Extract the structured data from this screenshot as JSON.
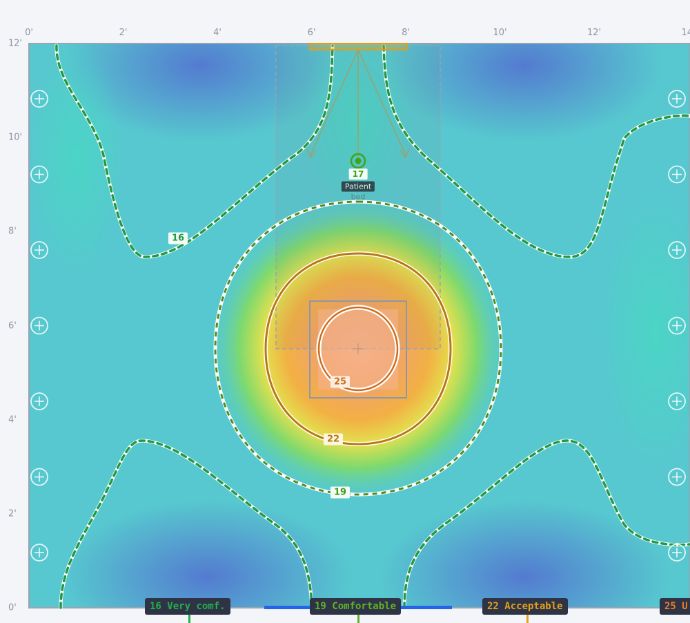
{
  "floorplan": {
    "x_ticks": [
      "0'",
      "2'",
      "4'",
      "6'",
      "8'",
      "10'",
      "12'",
      "14'"
    ],
    "y_ticks": [
      "12'",
      "10'",
      "8'",
      "6'",
      "4'",
      "2'",
      "0'"
    ],
    "contours": [
      {
        "value": "16",
        "color": "#1f9a45"
      },
      {
        "value": "25",
        "color": "#cf6d1c"
      },
      {
        "value": "22",
        "color": "#b9780f"
      },
      {
        "value": "19",
        "color": "#3f9a1f"
      }
    ],
    "sensor": {
      "value": "17",
      "label_line1": "Patient",
      "label_line2": "bed",
      "color": "#41a319"
    },
    "diffuser_icon": "plus-circle-icon",
    "vent_icon": "supply-vent-icon"
  },
  "legend": {
    "items": [
      {
        "label": "16 Very comf.",
        "color": "#21b04b"
      },
      {
        "label": "19 Comfortable",
        "color": "#5fb226"
      },
      {
        "label": "22 Acceptable",
        "color": "#e6a019"
      },
      {
        "label": "25 U",
        "color": "#ef7b22"
      }
    ],
    "bar_color": "#2563eb"
  }
}
